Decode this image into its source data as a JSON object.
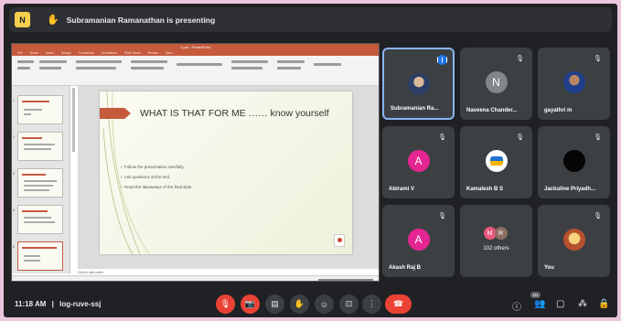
{
  "topbar": {
    "app_logo_text": "N",
    "presenting_text": "Subramanian Ramanathan is presenting"
  },
  "presentation": {
    "window_title": "1.ppt - PowerPoint",
    "ribbon_tabs": [
      "File",
      "Home",
      "Insert",
      "Design",
      "Transitions",
      "Animations",
      "Slide Show",
      "Review",
      "View"
    ],
    "slide_title": "WHAT IS THAT FOR ME …… know yourself",
    "bullets": [
      "Follow the presentation carefully.",
      "Ask questions at the end.",
      "Read the takeaways of the final slide."
    ],
    "notes_placeholder": "Click to add notes"
  },
  "participants": [
    {
      "name": "Subramanian Ra...",
      "avatar": "photo",
      "speaking": true
    },
    {
      "name": "Naveena Chander...",
      "initial": "N",
      "color": "#80868b"
    },
    {
      "name": "gayathri m",
      "avatar": "photo2"
    },
    {
      "name": "Abirami V",
      "initial": "A",
      "color": "#e52592"
    },
    {
      "name": "Kamalesh B S",
      "avatar": "logo"
    },
    {
      "name": "Jackuline Priyadh...",
      "avatar": "dark"
    },
    {
      "name": "Akash Raj B",
      "initial": "A",
      "color": "#e52592"
    },
    {
      "name": "102 others",
      "minis": [
        {
          "initial": "M",
          "color": "#e8577c"
        },
        {
          "initial": "R",
          "color": "#8d6e63"
        }
      ]
    },
    {
      "name": "You",
      "avatar": "you"
    }
  ],
  "bottombar": {
    "clock": "11:18 AM",
    "separator": "|",
    "meeting_code": "log-ruve-ssj",
    "people_count": "111"
  },
  "icons": {
    "present": "✋",
    "mic_off": "🎙",
    "speaking": "❙❙❙",
    "mic": "🎙",
    "camera": "📷",
    "captions": "▤",
    "hand": "✋",
    "emoji": "☺",
    "present_screen": "⊡",
    "more": "⋮",
    "end_call": "☎",
    "info": "ⓘ",
    "people": "👥",
    "chat": "▢",
    "activities": "⁂",
    "lock": "🔒"
  }
}
